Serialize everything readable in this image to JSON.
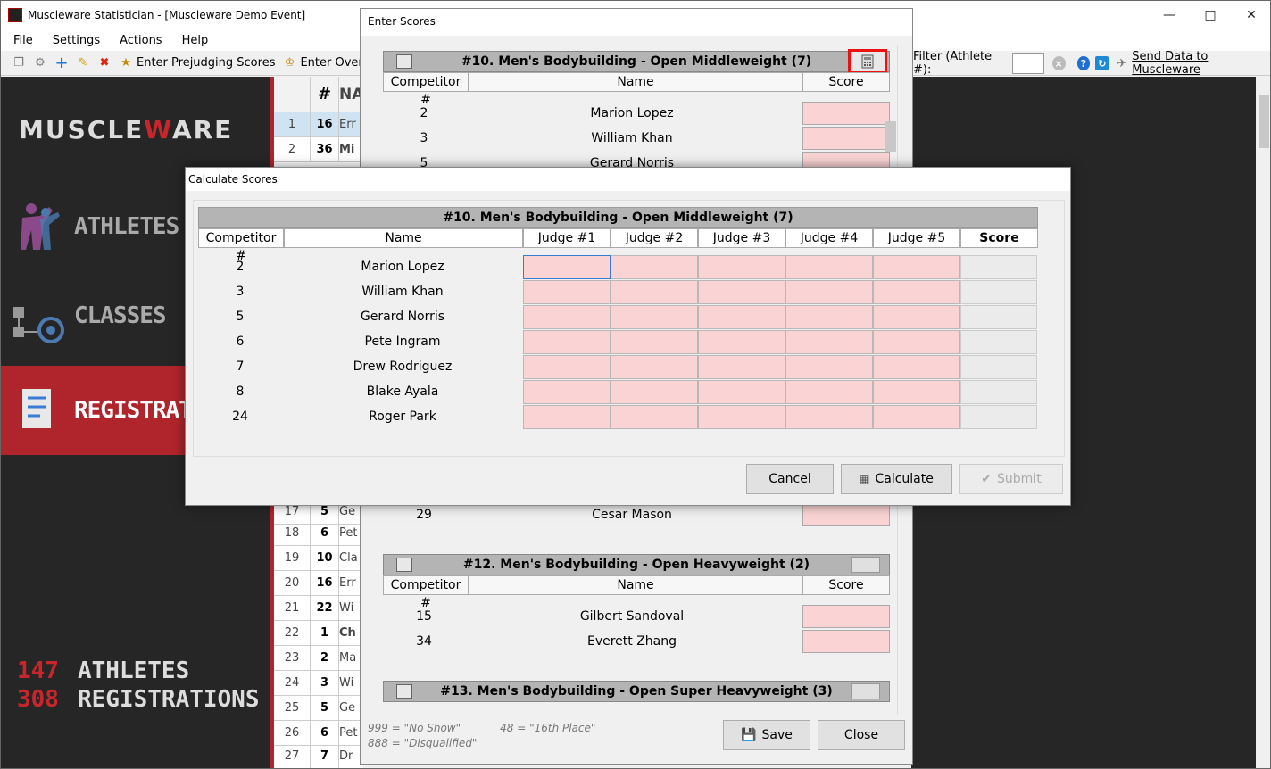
{
  "window": {
    "title": "Muscleware Statistician - [Muscleware Demo Event]"
  },
  "menu": [
    "File",
    "Settings",
    "Actions",
    "Help"
  ],
  "toolbar": {
    "prejudging": "Enter Prejudging Scores",
    "overall": "Enter Overa",
    "filter_label": "Filter (Athlete #):",
    "send": "Send Data to Muscleware"
  },
  "sidebar": {
    "logo_a": "MUSCLE",
    "logo_b": "W",
    "logo_c": "ARE",
    "items": [
      {
        "label": "ATHLETES"
      },
      {
        "label": "CLASSES"
      },
      {
        "label": "REGISTRATIO"
      }
    ],
    "stats": [
      {
        "num": "147",
        "label": "ATHLETES"
      },
      {
        "num": "308",
        "label": "REGISTRATIONS"
      }
    ]
  },
  "grid": {
    "header_num": "#",
    "header_name": "NA",
    "rows_top": [
      {
        "idx": "1",
        "num": "16",
        "nm": "Err"
      },
      {
        "idx": "2",
        "num": "36",
        "nm": "Mi"
      }
    ],
    "rows_bottom": [
      {
        "idx": "17",
        "num": "5",
        "nm": "Ge"
      },
      {
        "idx": "18",
        "num": "6",
        "nm": "Pet"
      },
      {
        "idx": "19",
        "num": "10",
        "nm": "Cla"
      },
      {
        "idx": "20",
        "num": "16",
        "nm": "Err"
      },
      {
        "idx": "21",
        "num": "22",
        "nm": "Wi"
      },
      {
        "idx": "22",
        "num": "1",
        "nm": "Ch"
      },
      {
        "idx": "23",
        "num": "2",
        "nm": "Ma"
      },
      {
        "idx": "24",
        "num": "3",
        "nm": "Wi"
      },
      {
        "idx": "25",
        "num": "5",
        "nm": "Ge"
      },
      {
        "idx": "26",
        "num": "6",
        "nm": "Pet"
      },
      {
        "idx": "27",
        "num": "7",
        "nm": "Dr"
      }
    ]
  },
  "enter_scores": {
    "title": "Enter Scores",
    "groups": [
      {
        "title": "#10. Men's Bodybuilding - Open Middleweight (7)",
        "rows": [
          {
            "num": "2",
            "name": "Marion Lopez"
          },
          {
            "num": "3",
            "name": "William Khan"
          },
          {
            "num": "5",
            "name": "Gerard Norris"
          }
        ]
      },
      {
        "title": "#12. Men's Bodybuilding - Open Heavyweight (2)",
        "rows": [
          {
            "num": "15",
            "name": "Gilbert Sandoval"
          },
          {
            "num": "34",
            "name": "Everett Zhang"
          }
        ]
      },
      {
        "title": "#13. Men's Bodybuilding - Open Super Heavyweight (3)",
        "rows": []
      }
    ],
    "partial_row": {
      "num": "29",
      "name": "Cesar Mason"
    },
    "col_competitor": "Competitor #",
    "col_name": "Name",
    "col_score": "Score",
    "legend_1": "999 = \"No Show\"",
    "legend_2": "48 = \"16th Place\"",
    "legend_3": "888 = \"Disqualified\"",
    "save": "Save",
    "close": "Close"
  },
  "calc": {
    "title": "Calculate Scores",
    "group_title": "#10. Men's Bodybuilding - Open Middleweight (7)",
    "cols": [
      "Competitor #",
      "Name",
      "Judge #1",
      "Judge #2",
      "Judge #3",
      "Judge #4",
      "Judge #5",
      "Score"
    ],
    "rows": [
      {
        "num": "2",
        "name": "Marion Lopez"
      },
      {
        "num": "3",
        "name": "William Khan"
      },
      {
        "num": "5",
        "name": "Gerard Norris"
      },
      {
        "num": "6",
        "name": "Pete Ingram"
      },
      {
        "num": "7",
        "name": "Drew Rodriguez"
      },
      {
        "num": "8",
        "name": "Blake Ayala"
      },
      {
        "num": "24",
        "name": "Roger Park"
      }
    ],
    "cancel": "Cancel",
    "calculate": "Calculate",
    "submit": "Submit"
  },
  "colors": {
    "accent_red": "#b0252b",
    "score_cell": "#fad4d4"
  }
}
